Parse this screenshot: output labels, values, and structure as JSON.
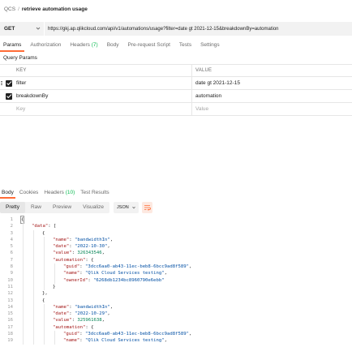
{
  "breadcrumb": {
    "parent": "QCS",
    "separator": "/",
    "current": "retrieve automation usage"
  },
  "request": {
    "method": "GET",
    "url": "https://gkj.ap.qlikcloud.com/api/v1/automations/usage?filter=date gt 2021-12-15&breakdownBy=automation"
  },
  "request_tabs": [
    {
      "label": "Params",
      "count": ""
    },
    {
      "label": "Authorization",
      "count": ""
    },
    {
      "label": "Headers",
      "count": "(7)"
    },
    {
      "label": "Body",
      "count": ""
    },
    {
      "label": "Pre-request Script",
      "count": ""
    },
    {
      "label": "Tests",
      "count": ""
    },
    {
      "label": "Settings",
      "count": ""
    }
  ],
  "query_params": {
    "section_title": "Query Params",
    "headers": {
      "key": "KEY",
      "value": "VALUE"
    },
    "rows": [
      {
        "key": "filter",
        "value": "date gt 2021-12-15",
        "checked": true
      },
      {
        "key": "breakdownBy",
        "value": "automation",
        "checked": true
      }
    ],
    "placeholder": {
      "key": "Key",
      "value": "Value"
    }
  },
  "response_tabs": [
    {
      "label": "Body",
      "count": ""
    },
    {
      "label": "Cookies",
      "count": ""
    },
    {
      "label": "Headers",
      "count": "(10)"
    },
    {
      "label": "Test Results",
      "count": ""
    }
  ],
  "response_view": {
    "modes": [
      "Pretty",
      "Raw",
      "Preview",
      "Visualize"
    ],
    "active_mode": "Pretty",
    "language": "JSON"
  },
  "code_lines": [
    {
      "n": "1",
      "indent": 0,
      "text": "{"
    },
    {
      "n": "2",
      "indent": 1,
      "text": "\"data\": ["
    },
    {
      "n": "3",
      "indent": 2,
      "text": "{"
    },
    {
      "n": "4",
      "indent": 3,
      "text": "\"name\": \"bandwidthIn\","
    },
    {
      "n": "5",
      "indent": 3,
      "text": "\"date\": \"2022-10-30\","
    },
    {
      "n": "6",
      "indent": 3,
      "text": "\"value\": 326343546,"
    },
    {
      "n": "7",
      "indent": 3,
      "text": "\"automation\": {"
    },
    {
      "n": "8",
      "indent": 4,
      "text": "\"guid\": \"3dcc6aa0-ab43-11ec-beb8-6bcc9ad8f589\","
    },
    {
      "n": "9",
      "indent": 4,
      "text": "\"name\": \"Qlik Cloud Services testing\","
    },
    {
      "n": "10",
      "indent": 4,
      "text": "\"ownerId\": \"6268db1234bc8960790e6ebb\""
    },
    {
      "n": "11",
      "indent": 3,
      "text": "}"
    },
    {
      "n": "12",
      "indent": 2,
      "text": "},"
    },
    {
      "n": "13",
      "indent": 2,
      "text": "{"
    },
    {
      "n": "14",
      "indent": 3,
      "text": "\"name\": \"bandwidthIn\","
    },
    {
      "n": "15",
      "indent": 3,
      "text": "\"date\": \"2022-10-29\","
    },
    {
      "n": "16",
      "indent": 3,
      "text": "\"value\": 325961638,"
    },
    {
      "n": "17",
      "indent": 3,
      "text": "\"automation\": {"
    },
    {
      "n": "18",
      "indent": 4,
      "text": "\"guid\": \"3dcc6aa0-ab43-11ec-beb8-6bcc9ad8f589\","
    },
    {
      "n": "19",
      "indent": 4,
      "text": "\"name\": \"Qlik Cloud Services testing\","
    }
  ],
  "colors": {
    "accent": "#ff6c37",
    "count": "#0cbb52",
    "key": "#a31515",
    "string": "#0451a5",
    "number": "#098658"
  },
  "icons": {
    "method_dropdown": "chevron-down-icon",
    "drag_handle": "drag-handle-icon",
    "checkbox": "checkbox-checked-icon",
    "wrap": "wrap-lines-icon"
  }
}
